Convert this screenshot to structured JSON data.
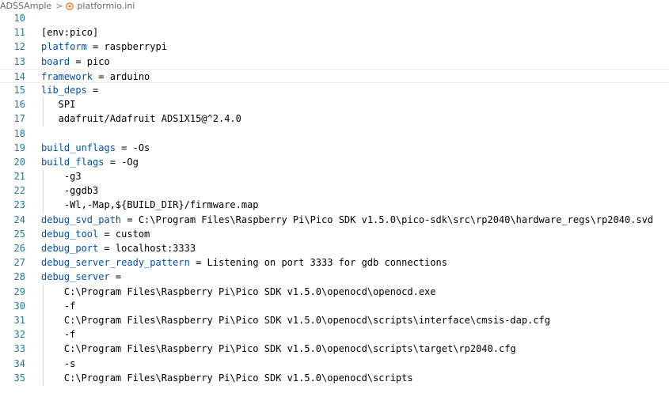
{
  "breadcrumb": {
    "folder": "ADSSAmple",
    "separator": ">",
    "file": "platformio.ini",
    "file_icon": "platformio-ini-icon"
  },
  "colors": {
    "key": "#0451a5",
    "line_number": "#237893",
    "text": "#000000",
    "indent_guide": "#d3d3d3"
  },
  "lines": [
    {
      "n": "10",
      "key": "",
      "rest": ""
    },
    {
      "n": "11",
      "key": "",
      "rest": "[env:pico]"
    },
    {
      "n": "12",
      "key": "platform",
      "rest": " = raspberrypi"
    },
    {
      "n": "13",
      "key": "board",
      "rest": " = pico"
    },
    {
      "n": "14",
      "key": "framework",
      "rest": " = arduino"
    },
    {
      "n": "15",
      "key": "lib_deps",
      "rest": " ="
    },
    {
      "n": "16",
      "key": "",
      "rest": "   SPI"
    },
    {
      "n": "17",
      "key": "",
      "rest": "   adafruit/Adafruit ADS1X15@^2.4.0"
    },
    {
      "n": "18",
      "key": "",
      "rest": ""
    },
    {
      "n": "19",
      "key": "build_unflags",
      "rest": " = -Os"
    },
    {
      "n": "20",
      "key": "build_flags",
      "rest": " = -Og"
    },
    {
      "n": "21",
      "key": "",
      "rest": "    -g3"
    },
    {
      "n": "22",
      "key": "",
      "rest": "    -ggdb3"
    },
    {
      "n": "23",
      "key": "",
      "rest": "    -Wl,-Map,${BUILD_DIR}/firmware.map"
    },
    {
      "n": "24",
      "key": "debug_svd_path",
      "rest": " = C:\\Program Files\\Raspberry Pi\\Pico SDK v1.5.0\\pico-sdk\\src\\rp2040\\hardware_regs\\rp2040.svd"
    },
    {
      "n": "25",
      "key": "debug_tool",
      "rest": " = custom"
    },
    {
      "n": "26",
      "key": "debug_port",
      "rest": " = localhost:3333"
    },
    {
      "n": "27",
      "key": "debug_server_ready_pattern",
      "rest": " = Listening on port 3333 for gdb connections"
    },
    {
      "n": "28",
      "key": "debug_server",
      "rest": " ="
    },
    {
      "n": "29",
      "key": "",
      "rest": "    C:\\Program Files\\Raspberry Pi\\Pico SDK v1.5.0\\openocd\\openocd.exe"
    },
    {
      "n": "30",
      "key": "",
      "rest": "    -f"
    },
    {
      "n": "31",
      "key": "",
      "rest": "    C:\\Program Files\\Raspberry Pi\\Pico SDK v1.5.0\\openocd\\scripts\\interface\\cmsis-dap.cfg"
    },
    {
      "n": "32",
      "key": "",
      "rest": "    -f"
    },
    {
      "n": "33",
      "key": "",
      "rest": "    C:\\Program Files\\Raspberry Pi\\Pico SDK v1.5.0\\openocd\\scripts\\target\\rp2040.cfg"
    },
    {
      "n": "34",
      "key": "",
      "rest": "    -s"
    },
    {
      "n": "35",
      "key": "",
      "rest": "    C:\\Program Files\\Raspberry Pi\\Pico SDK v1.5.0\\openocd\\scripts"
    }
  ]
}
